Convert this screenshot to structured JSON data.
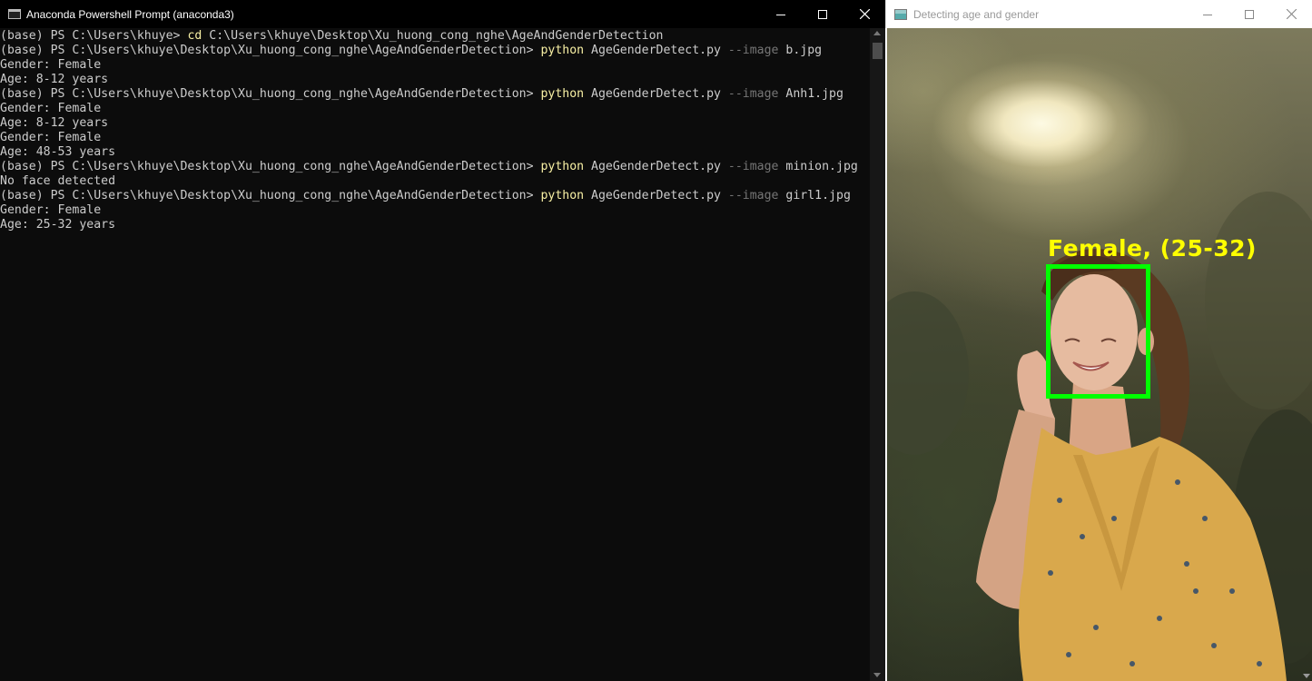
{
  "terminal": {
    "title": "Anaconda Powershell Prompt (anaconda3)",
    "lines": [
      {
        "prefix": "(base) PS C:\\Users\\khuye> ",
        "cmd": "cd",
        "args": " C:\\Users\\khuye\\Desktop\\Xu_huong_cong_nghe\\AgeAndGenderDetection",
        "param": "",
        "value": ""
      },
      {
        "prefix": "(base) PS C:\\Users\\khuye\\Desktop\\Xu_huong_cong_nghe\\AgeAndGenderDetection> ",
        "cmd": "python",
        "args": " AgeGenderDetect.py ",
        "param": "--image",
        "value": " b.jpg"
      },
      {
        "text": "Gender: Female"
      },
      {
        "text": "Age: 8-12 years"
      },
      {
        "prefix": "(base) PS C:\\Users\\khuye\\Desktop\\Xu_huong_cong_nghe\\AgeAndGenderDetection> ",
        "cmd": "python",
        "args": " AgeGenderDetect.py ",
        "param": "--image",
        "value": " Anh1.jpg"
      },
      {
        "text": "Gender: Female"
      },
      {
        "text": "Age: 8-12 years"
      },
      {
        "text": "Gender: Female"
      },
      {
        "text": "Age: 48-53 years"
      },
      {
        "prefix": "(base) PS C:\\Users\\khuye\\Desktop\\Xu_huong_cong_nghe\\AgeAndGenderDetection> ",
        "cmd": "python",
        "args": " AgeGenderDetect.py ",
        "param": "--image",
        "value": " minion.jpg"
      },
      {
        "text": "No face detected"
      },
      {
        "prefix": "(base) PS C:\\Users\\khuye\\Desktop\\Xu_huong_cong_nghe\\AgeAndGenderDetection> ",
        "cmd": "python",
        "args": " AgeGenderDetect.py ",
        "param": "--image",
        "value": " girl1.jpg"
      },
      {
        "text": "Gender: Female"
      },
      {
        "text": "Age: 25-32 years"
      }
    ]
  },
  "image_window": {
    "title": "Detecting age and gender",
    "detection_label": "Female, (25-32)"
  },
  "colors": {
    "terminal_bg": "#0c0c0c",
    "terminal_text": "#cccccc",
    "command": "#f9f1a5",
    "parameter": "#767676",
    "label": "#ffff00",
    "box": "#00ff00"
  }
}
